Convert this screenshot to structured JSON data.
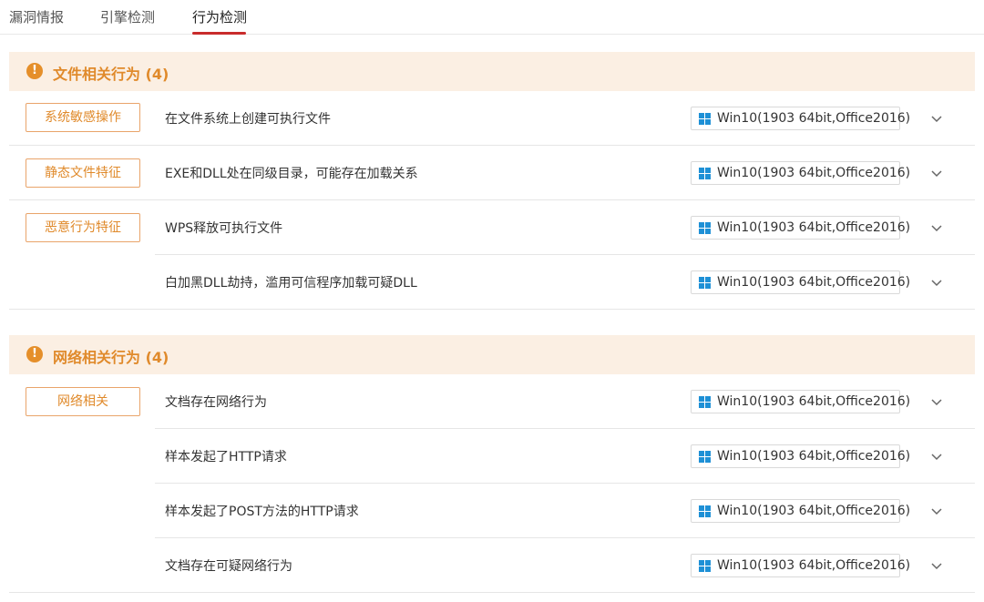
{
  "tabs": [
    {
      "label": "漏洞情报",
      "active": false
    },
    {
      "label": "引擎检测",
      "active": false
    },
    {
      "label": "行为检测",
      "active": true
    }
  ],
  "colors": {
    "accent": "#e08a2b",
    "header_bg": "#fbefe3",
    "active_tab_underline": "#c92b2b",
    "windows_logo": "#1e90d6"
  },
  "sections": [
    {
      "title": "文件相关行为 (4)",
      "icon": "warning-icon",
      "categories": [
        "系统敏感操作",
        "静态文件特征",
        "恶意行为特征"
      ],
      "rows": [
        {
          "label": "在文件系统上创建可执行文件",
          "env": "Win10(1903 64bit,Office2016)"
        },
        {
          "label": "EXE和DLL处在同级目录，可能存在加载关系",
          "env": "Win10(1903 64bit,Office2016)"
        },
        {
          "label": "WPS释放可执行文件",
          "env": "Win10(1903 64bit,Office2016)"
        },
        {
          "label": "白加黑DLL劫持，滥用可信程序加载可疑DLL",
          "env": "Win10(1903 64bit,Office2016)"
        }
      ]
    },
    {
      "title": "网络相关行为 (4)",
      "icon": "warning-icon",
      "categories": [
        "网络相关"
      ],
      "rows": [
        {
          "label": "文档存在网络行为",
          "env": "Win10(1903 64bit,Office2016)"
        },
        {
          "label": "样本发起了HTTP请求",
          "env": "Win10(1903 64bit,Office2016)"
        },
        {
          "label": "样本发起了POST方法的HTTP请求",
          "env": "Win10(1903 64bit,Office2016)"
        },
        {
          "label": "文档存在可疑网络行为",
          "env": "Win10(1903 64bit,Office2016)"
        }
      ]
    }
  ]
}
